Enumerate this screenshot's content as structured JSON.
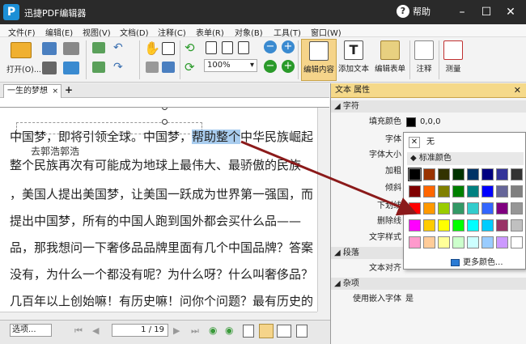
{
  "app": {
    "title": "迅捷PDF编辑器",
    "help": "帮助"
  },
  "menu": [
    "文件(F)",
    "编辑(E)",
    "视图(V)",
    "文档(D)",
    "注释(C)",
    "表单(R)",
    "对象(B)",
    "工具(T)",
    "窗口(W)"
  ],
  "toolbar": {
    "open_label": "打开(O)...",
    "zoom_value": "100%",
    "edit_content": "编辑内容",
    "add_text": "添加文本",
    "edit_form": "编辑表单",
    "annotate": "注释",
    "measure": "测量"
  },
  "tab": {
    "title": "一生的梦想",
    "close": "×",
    "add": "+"
  },
  "document": {
    "lines": [
      {
        "before": "中国梦，即将引领全球。中国梦，",
        "highlight": "帮助整个",
        "after": "中华民族崛起"
      },
      {
        "before": "整个民族再次有可能成为地球上最伟大、最骄傲的民族",
        "highlight": "",
        "after": ""
      },
      {
        "before": "，美国人提出美国梦，让美国一跃成为世界第一强国，而",
        "highlight": "",
        "after": ""
      },
      {
        "before": "提出中国梦，所有的中国人跑到国外都会买什么品——",
        "highlight": "",
        "after": ""
      },
      {
        "before": "品，那我想问一下奢侈品品牌里面有几个中国品牌？答案",
        "highlight": "",
        "after": ""
      },
      {
        "before": "没有，为什么一个都没有呢？为什么呀？什么叫奢侈品？",
        "highlight": "",
        "after": ""
      },
      {
        "before": "几百年以上创始嘛！有历史嘛！问你个问题？最有历史的",
        "highlight": "",
        "after": ""
      }
    ],
    "overlay_text": "去郭浩郭浩"
  },
  "status": {
    "options_label": "选项...",
    "page_display": "1 / 19"
  },
  "panel": {
    "title": "文本 属性",
    "sections": {
      "chars": "字符",
      "paragraph": "段落",
      "misc": "杂项"
    },
    "rows": {
      "fill_color": "填充颜色",
      "fill_value": "0,0,0",
      "font": "字体",
      "font_size": "字体大小",
      "bold": "加粗",
      "italic": "倾斜",
      "underline": "下划线",
      "strike": "删除线",
      "text_style": "文字样式",
      "text_align": "文本对齐",
      "embed_font": "使用嵌入字体",
      "embed_value": "是"
    }
  },
  "color_popup": {
    "none": "无",
    "none_mark": "✕",
    "standard": "标准颜色",
    "more": "更多颜色...",
    "swatches": [
      "#000000",
      "#993300",
      "#333300",
      "#003300",
      "#003366",
      "#000080",
      "#333399",
      "#333333",
      "#800000",
      "#ff6600",
      "#808000",
      "#008000",
      "#008080",
      "#0000ff",
      "#666699",
      "#808080",
      "#ff0000",
      "#ff9900",
      "#99cc00",
      "#339966",
      "#33cccc",
      "#3366ff",
      "#800080",
      "#969696",
      "#ff00ff",
      "#ffcc00",
      "#ffff00",
      "#00ff00",
      "#00ffff",
      "#00ccff",
      "#993366",
      "#c0c0c0",
      "#ff99cc",
      "#ffcc99",
      "#ffff99",
      "#ccffcc",
      "#ccffff",
      "#99ccff",
      "#cc99ff",
      "#ffffff"
    ]
  }
}
